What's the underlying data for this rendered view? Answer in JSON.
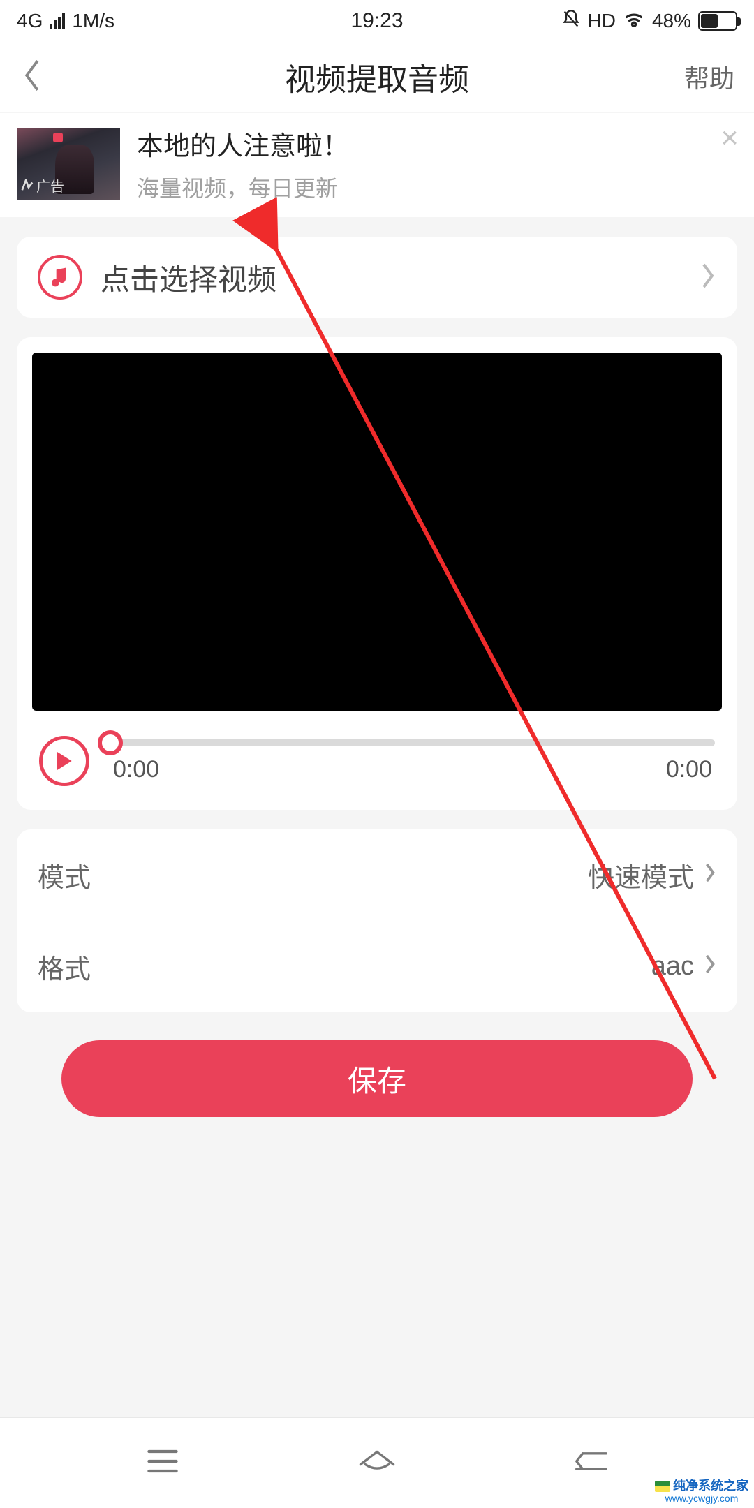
{
  "status": {
    "network": "4G",
    "speed": "1M/s",
    "time": "19:23",
    "hd": "HD",
    "battery_pct": "48%"
  },
  "header": {
    "title": "视频提取音频",
    "help": "帮助"
  },
  "ad": {
    "title": "本地的人注意啦！",
    "subtitle": "海量视频，每日更新",
    "badge": "广告"
  },
  "select": {
    "label": "点击选择视频"
  },
  "player": {
    "time_left": "0:00",
    "time_right": "0:00"
  },
  "settings": {
    "mode_label": "模式",
    "mode_value": "快速模式",
    "format_label": "格式",
    "format_value": "aac"
  },
  "save_label": "保存",
  "watermark": {
    "name": "纯净系统之家",
    "url": "www.ycwgjy.com"
  }
}
